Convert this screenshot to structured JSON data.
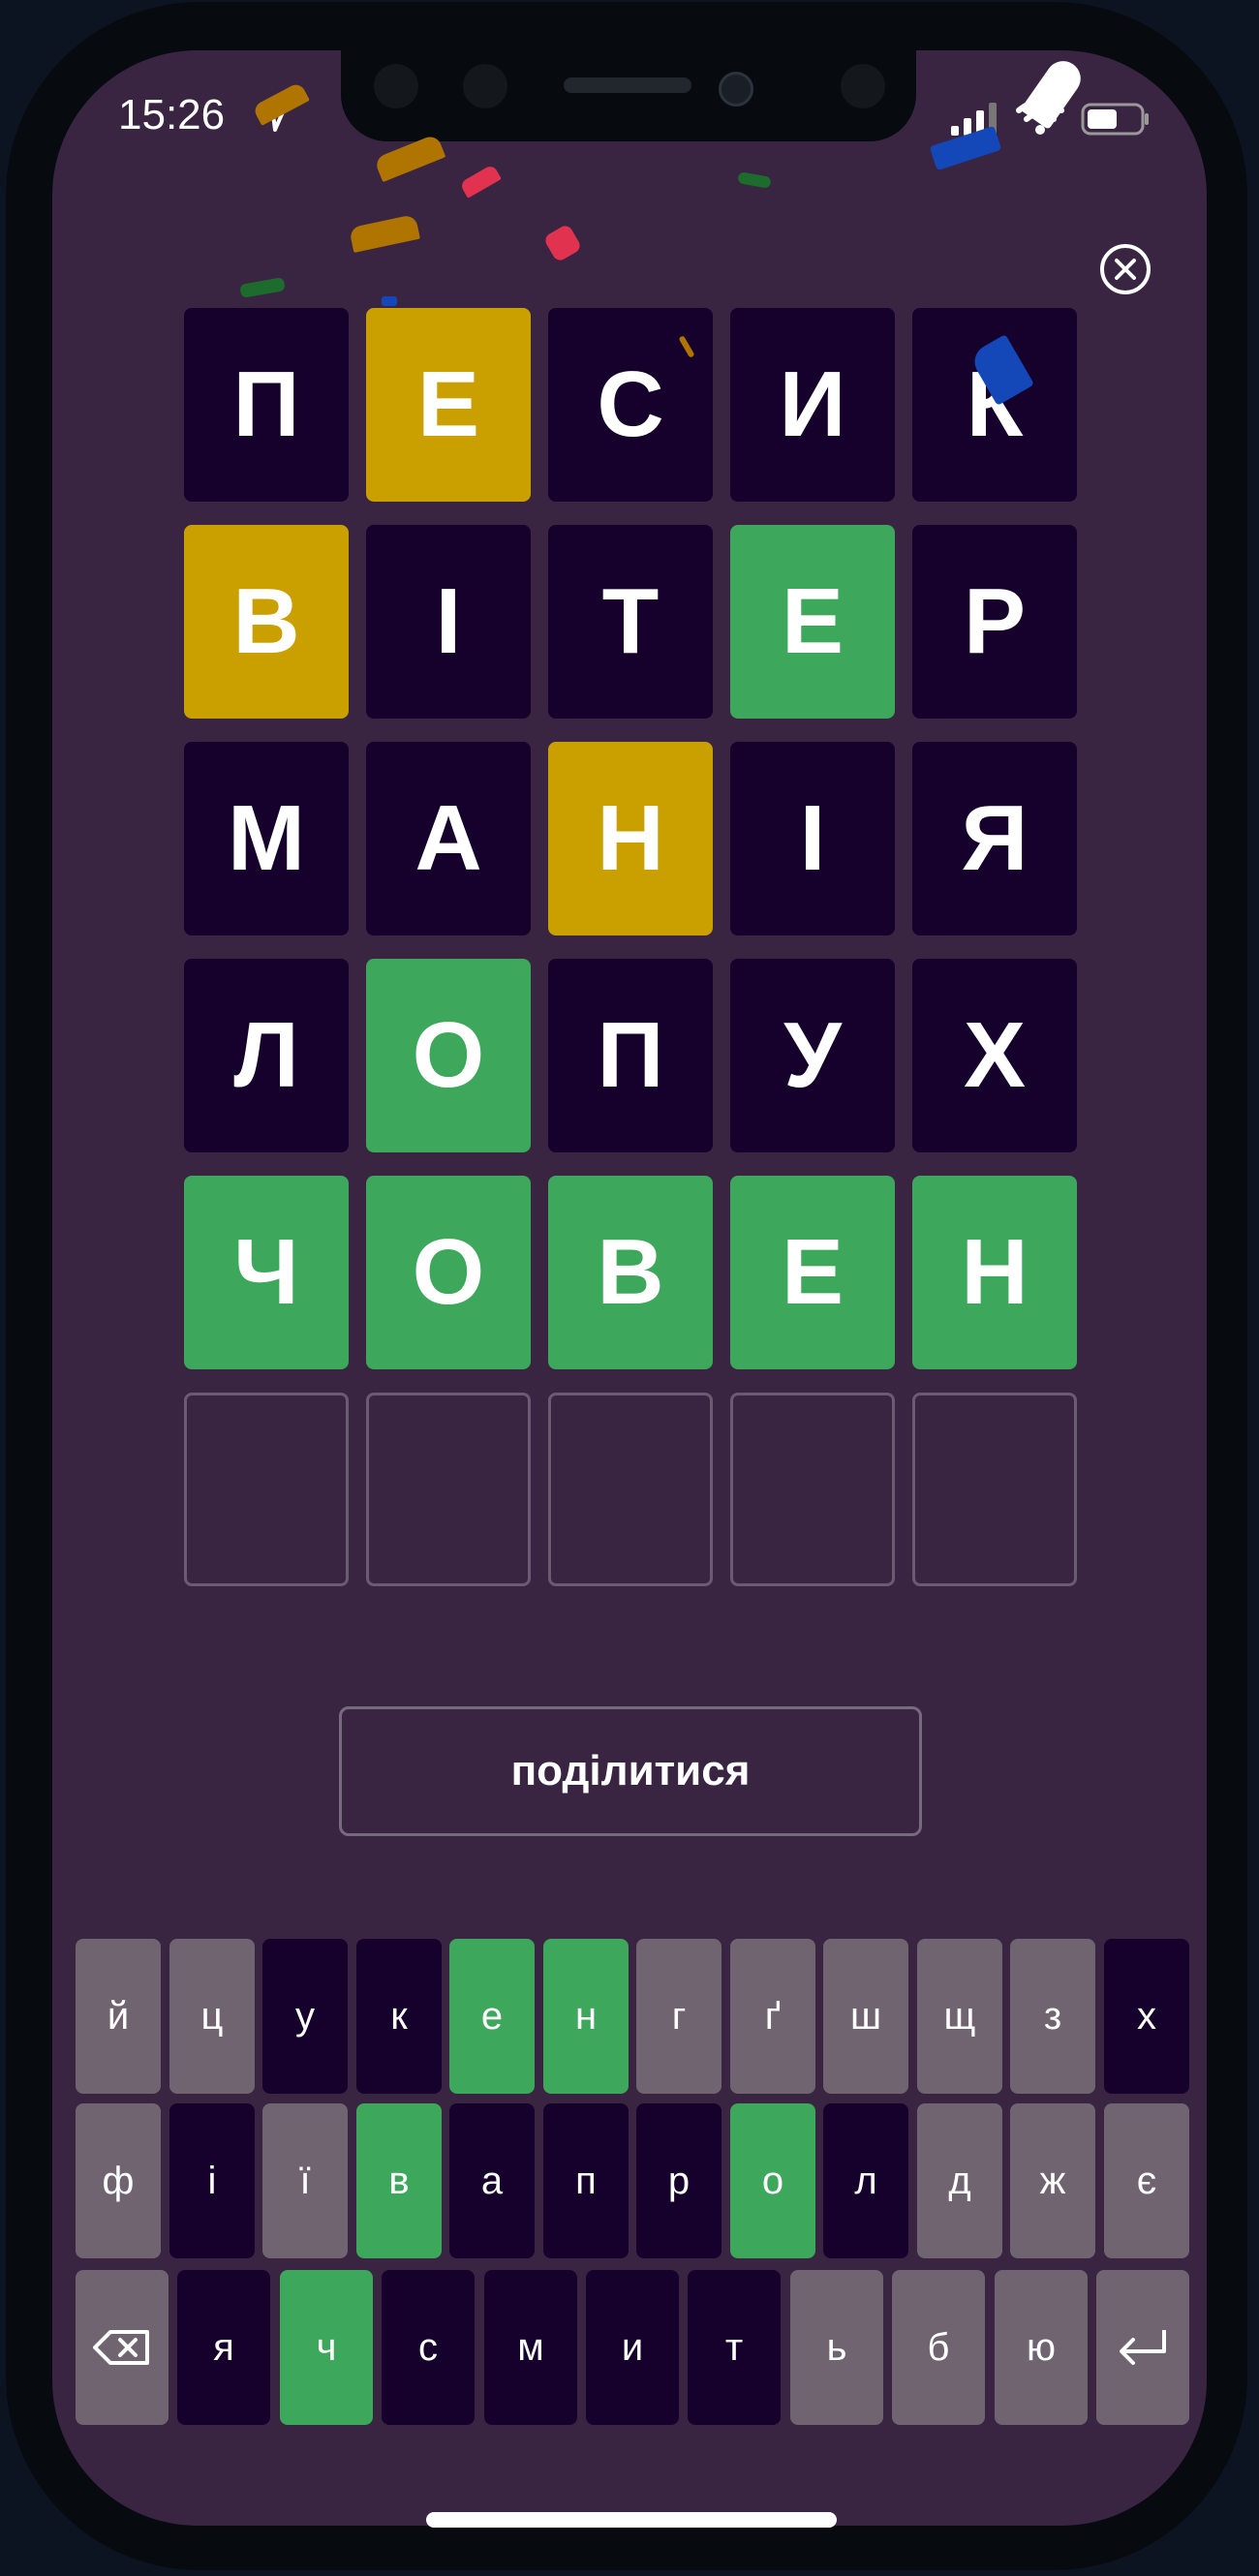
{
  "status_bar": {
    "time": "15:26"
  },
  "board": {
    "rows": [
      [
        {
          "letter": "П",
          "state": "absent"
        },
        {
          "letter": "Е",
          "state": "present"
        },
        {
          "letter": "С",
          "state": "absent"
        },
        {
          "letter": "И",
          "state": "absent"
        },
        {
          "letter": "К",
          "state": "absent"
        }
      ],
      [
        {
          "letter": "В",
          "state": "present"
        },
        {
          "letter": "І",
          "state": "absent"
        },
        {
          "letter": "Т",
          "state": "absent"
        },
        {
          "letter": "Е",
          "state": "correct"
        },
        {
          "letter": "Р",
          "state": "absent"
        }
      ],
      [
        {
          "letter": "М",
          "state": "absent"
        },
        {
          "letter": "А",
          "state": "absent"
        },
        {
          "letter": "Н",
          "state": "present"
        },
        {
          "letter": "І",
          "state": "absent"
        },
        {
          "letter": "Я",
          "state": "absent"
        }
      ],
      [
        {
          "letter": "Л",
          "state": "absent"
        },
        {
          "letter": "О",
          "state": "correct"
        },
        {
          "letter": "П",
          "state": "absent"
        },
        {
          "letter": "У",
          "state": "absent"
        },
        {
          "letter": "Х",
          "state": "absent"
        }
      ],
      [
        {
          "letter": "Ч",
          "state": "correct"
        },
        {
          "letter": "О",
          "state": "correct"
        },
        {
          "letter": "В",
          "state": "correct"
        },
        {
          "letter": "Е",
          "state": "correct"
        },
        {
          "letter": "Н",
          "state": "correct"
        }
      ],
      [
        {
          "letter": "",
          "state": "empty"
        },
        {
          "letter": "",
          "state": "empty"
        },
        {
          "letter": "",
          "state": "empty"
        },
        {
          "letter": "",
          "state": "empty"
        },
        {
          "letter": "",
          "state": "empty"
        }
      ]
    ]
  },
  "share_button": {
    "label": "поділитися"
  },
  "keyboard": {
    "rows": [
      [
        {
          "label": "й",
          "state": "unused"
        },
        {
          "label": "ц",
          "state": "unused"
        },
        {
          "label": "у",
          "state": "absent"
        },
        {
          "label": "к",
          "state": "absent"
        },
        {
          "label": "е",
          "state": "correct"
        },
        {
          "label": "н",
          "state": "correct"
        },
        {
          "label": "г",
          "state": "unused"
        },
        {
          "label": "ґ",
          "state": "unused"
        },
        {
          "label": "ш",
          "state": "unused"
        },
        {
          "label": "щ",
          "state": "unused"
        },
        {
          "label": "з",
          "state": "unused"
        },
        {
          "label": "х",
          "state": "absent"
        }
      ],
      [
        {
          "label": "ф",
          "state": "unused"
        },
        {
          "label": "і",
          "state": "absent"
        },
        {
          "label": "ї",
          "state": "unused"
        },
        {
          "label": "в",
          "state": "correct"
        },
        {
          "label": "а",
          "state": "absent"
        },
        {
          "label": "п",
          "state": "absent"
        },
        {
          "label": "р",
          "state": "absent"
        },
        {
          "label": "о",
          "state": "correct"
        },
        {
          "label": "л",
          "state": "absent"
        },
        {
          "label": "д",
          "state": "unused"
        },
        {
          "label": "ж",
          "state": "unused"
        },
        {
          "label": "є",
          "state": "unused"
        }
      ],
      [
        {
          "label": "",
          "icon": "backspace-icon",
          "state": "unused"
        },
        {
          "label": "я",
          "state": "absent"
        },
        {
          "label": "ч",
          "state": "correct"
        },
        {
          "label": "с",
          "state": "absent"
        },
        {
          "label": "м",
          "state": "absent"
        },
        {
          "label": "и",
          "state": "absent"
        },
        {
          "label": "т",
          "state": "absent"
        },
        {
          "label": "ь",
          "state": "unused"
        },
        {
          "label": "б",
          "state": "unused"
        },
        {
          "label": "ю",
          "state": "unused"
        },
        {
          "label": "",
          "icon": "enter-icon",
          "state": "unused"
        }
      ]
    ]
  },
  "colors": {
    "background": "#392542",
    "absent": "#15012b",
    "present": "#c9a000",
    "correct": "#3da75b",
    "unused_key": "#716471",
    "empty_border": "#6b5a72"
  }
}
